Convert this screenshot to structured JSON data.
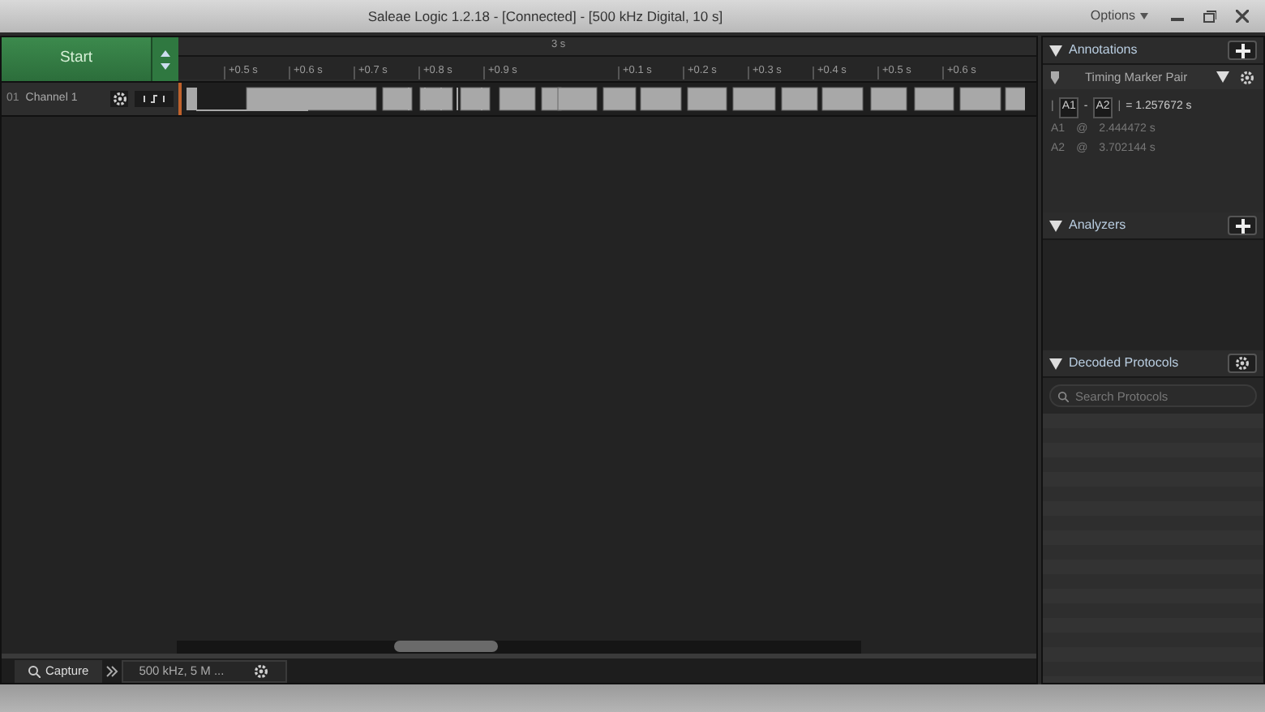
{
  "window": {
    "title": "Saleae Logic 1.2.18 - [Connected] - [500 kHz Digital, 10 s]",
    "options": "Options"
  },
  "start_button": {
    "label": "Start"
  },
  "ruler": {
    "span_label": "3 s",
    "ticks": [
      "+0.5 s",
      "+0.6 s",
      "+0.7 s",
      "+0.8 s",
      "+0.9 s",
      "+0.1 s",
      "+0.2 s",
      "+0.3 s",
      "+0.4 s",
      "+0.5 s",
      "+0.6 s"
    ]
  },
  "channels": [
    {
      "number": "01",
      "name": "Channel 1"
    }
  ],
  "annotations": {
    "title": "Annotations",
    "marker_type": "Timing Marker Pair",
    "measurement": {
      "bar": "|",
      "from": "A1",
      "separator": "-",
      "to": "A2",
      "value": "= 1.257672 s"
    },
    "markers": [
      {
        "label": "A1",
        "at": "@",
        "time": "2.444472 s"
      },
      {
        "label": "A2",
        "at": "@",
        "time": "3.702144 s"
      }
    ]
  },
  "analyzers": {
    "title": "Analyzers"
  },
  "decoded_protocols": {
    "title": "Decoded Protocols",
    "search": {
      "placeholder": "Search Protocols"
    }
  },
  "bottom_tabs": [
    {
      "label": "Capture",
      "kind": "capture"
    },
    {
      "label": "500 kHz, 5 M ...",
      "kind": "session"
    }
  ]
}
